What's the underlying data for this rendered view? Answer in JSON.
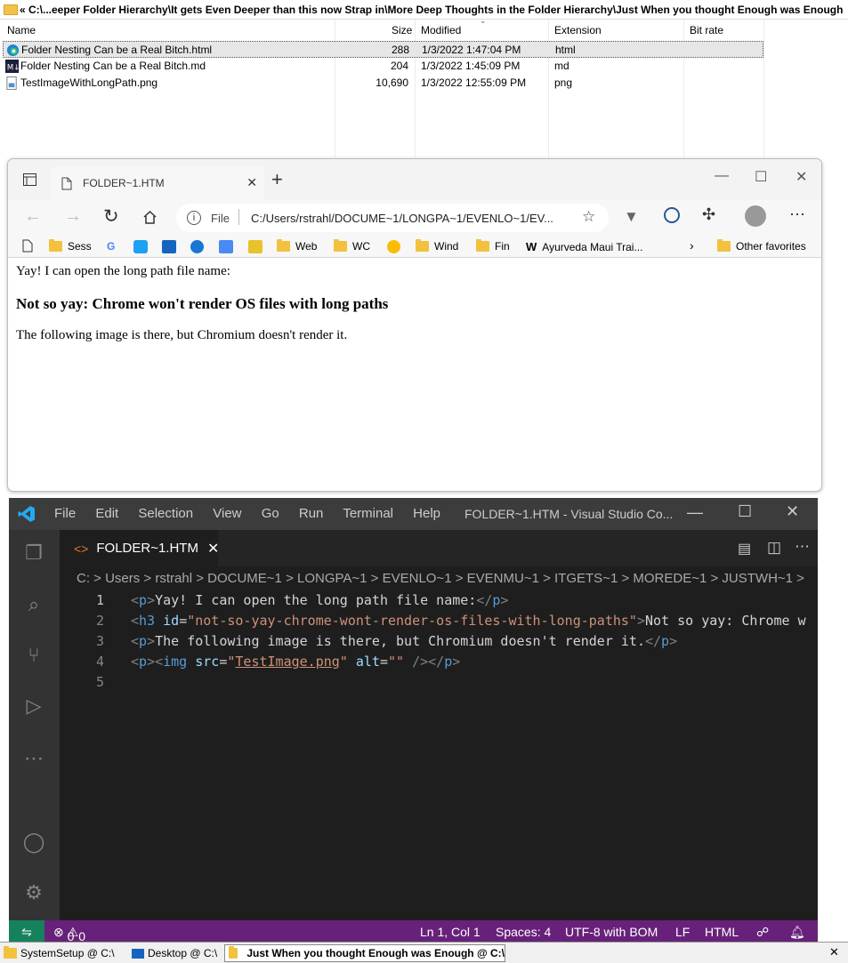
{
  "explorer": {
    "path": "« C:\\...eeper Folder Hierarchy\\It gets Even Deeper than this now Strap in\\More Deep Thoughts in the Folder Hierarchy\\Just When you thought Enough was Enough",
    "columns": {
      "name": "Name",
      "size": "Size",
      "modified": "Modified",
      "extension": "Extension",
      "bitrate": "Bit rate"
    },
    "files": [
      {
        "name": "Folder Nesting Can be a Real Bitch.html",
        "size": "288",
        "modified": "1/3/2022 1:47:04 PM",
        "ext": "html",
        "icon": "edge-icon"
      },
      {
        "name": "Folder Nesting Can be a Real Bitch.md",
        "size": "204",
        "modified": "1/3/2022 1:45:09 PM",
        "ext": "md",
        "icon": "markdown-icon"
      },
      {
        "name": "TestImageWithLongPath.png",
        "size": "10,690",
        "modified": "1/3/2022 12:55:09 PM",
        "ext": "png",
        "icon": "image-file-icon"
      }
    ]
  },
  "edge": {
    "tab_title": "FOLDER~1.HTM",
    "site_label": "File",
    "address": "C:/Users/rstrahl/DOCUME~1/LONGPA~1/EVENLO~1/EV...",
    "favorites": [
      "Sess",
      "Web",
      "WC",
      "Wind",
      "Fin",
      "Ayurveda Maui Trai...",
      "Other favorites"
    ],
    "content": {
      "p1": "Yay! I can open the long path file name:",
      "h3": "Not so yay: Chrome won't render OS files with long paths",
      "p2": "The following image is there, but Chromium doesn't render it."
    }
  },
  "vscode": {
    "menu": [
      "File",
      "Edit",
      "Selection",
      "View",
      "Go",
      "Run",
      "Terminal",
      "Help"
    ],
    "window_title": "FOLDER~1.HTM - Visual Studio Co...",
    "tab": "FOLDER~1.HTM",
    "breadcrumb": "C: > Users > rstrahl > DOCUME~1 > LONGPA~1 > EVENLO~1 > EVENMU~1 > ITGETS~1 > MOREDE~1 > JUSTWH~1 >",
    "line_numbers": [
      "1",
      "2",
      "3",
      "4",
      "5"
    ],
    "status": {
      "problems": "0",
      "warnings": "0",
      "position": "Ln 1, Col 1",
      "spaces": "Spaces: 4",
      "encoding": "UTF-8 with BOM",
      "eol": "LF",
      "language": "HTML"
    }
  },
  "taskbar": [
    "SystemSetup @ C:\\",
    "Desktop @ C:\\",
    "Just When you thought Enough was Enough @ C:\\"
  ],
  "colors": {
    "vscode_status": "#68217a",
    "vscode_remote": "#16825d",
    "folder": "#f2c13e"
  }
}
